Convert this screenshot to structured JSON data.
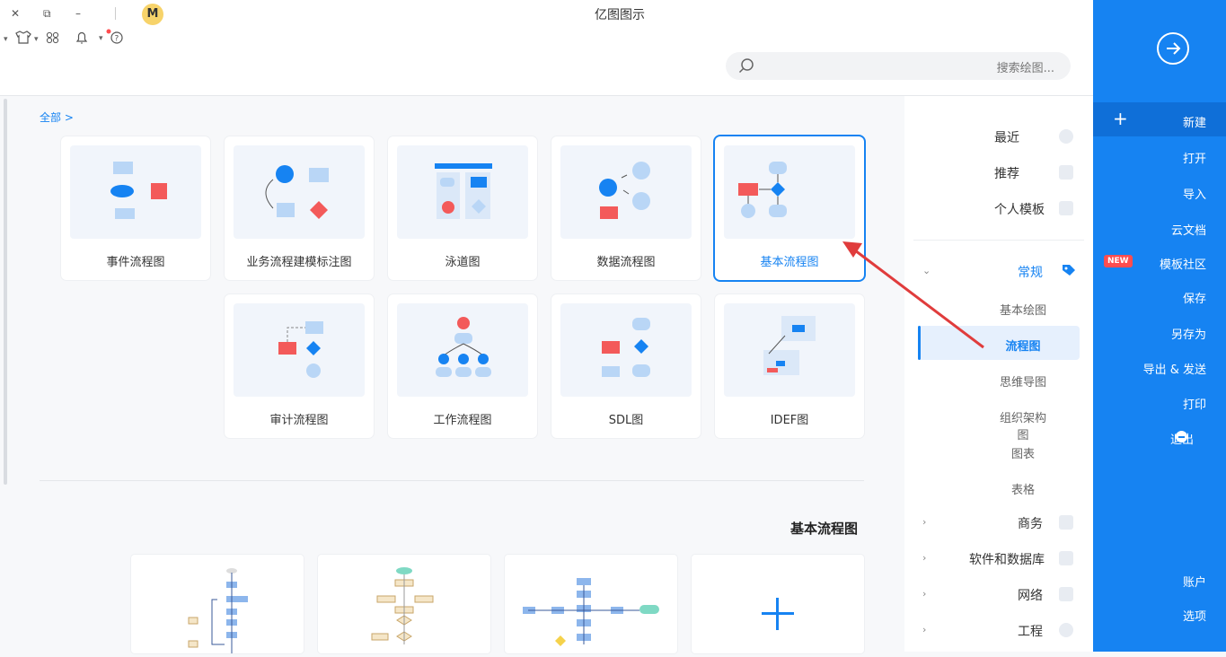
{
  "window": {
    "title": "亿图图示",
    "close_label": "✕",
    "restore_label": "⧉",
    "minimize_label": "–",
    "avatar_label": "M"
  },
  "toolbar": {
    "icons": [
      "tshirt-icon",
      "apps-icon",
      "bell-icon",
      "help-icon"
    ]
  },
  "search": {
    "placeholder": "搜索绘图..."
  },
  "blue_panel": {
    "items": [
      {
        "label": "新建"
      },
      {
        "label": "打开"
      },
      {
        "label": "导入"
      },
      {
        "label": "云文档"
      },
      {
        "label": "模板社区"
      },
      {
        "label": "保存"
      },
      {
        "label": "另存为"
      },
      {
        "label": "导出 & 发送"
      },
      {
        "label": "打印"
      },
      {
        "label": "退出"
      },
      {
        "label": "账户"
      },
      {
        "label": "选项"
      }
    ],
    "new_badge": "NEW"
  },
  "categories": {
    "top": [
      {
        "label": "最近"
      },
      {
        "label": "推荐"
      },
      {
        "label": "个人模板"
      }
    ],
    "group": {
      "label": "常规"
    },
    "subs": [
      {
        "label": "基本绘图"
      },
      {
        "label": "流程图"
      },
      {
        "label": "思维导图"
      },
      {
        "label": "组织架构图"
      },
      {
        "label": "图表"
      },
      {
        "label": "表格"
      }
    ],
    "more": [
      {
        "label": "商务"
      },
      {
        "label": "软件和数据库"
      },
      {
        "label": "网络"
      },
      {
        "label": "工程"
      }
    ]
  },
  "main": {
    "back_label": "全部 >",
    "cards": [
      {
        "label": "基本流程图"
      },
      {
        "label": "数据流程图"
      },
      {
        "label": "泳道图"
      },
      {
        "label": "业务流程建模标注图"
      },
      {
        "label": "事件流程图"
      },
      {
        "label": "IDEF图"
      },
      {
        "label": "SDL图"
      },
      {
        "label": "工作流程图"
      },
      {
        "label": "审计流程图"
      }
    ],
    "section_title": "基本流程图",
    "plus_label": "+"
  },
  "colors": {
    "accent": "#1683f2",
    "shape_red": "#f35a5a",
    "shape_blue": "#1683f2",
    "shape_light": "#b9d6f6"
  }
}
